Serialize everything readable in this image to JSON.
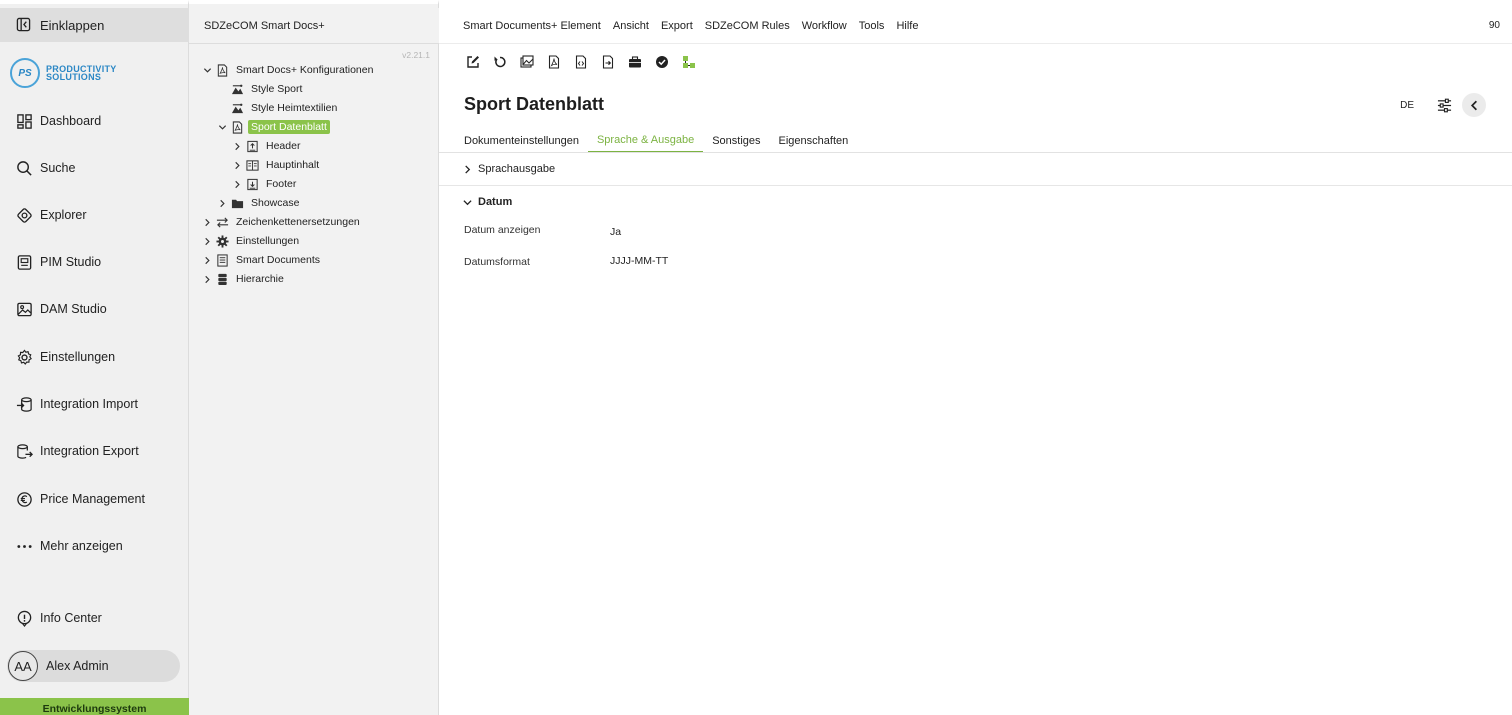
{
  "nav": {
    "collapse_label": "Einklappen",
    "logo_initials": "PS",
    "logo_line1": "PRODUCTIVITY",
    "logo_line2": "SOLUTIONS",
    "items": [
      {
        "label": "Dashboard",
        "icon": "dashboard-icon"
      },
      {
        "label": "Suche",
        "icon": "search-icon"
      },
      {
        "label": "Explorer",
        "icon": "explorer-icon"
      },
      {
        "label": "PIM Studio",
        "icon": "pim-studio-icon"
      },
      {
        "label": "DAM Studio",
        "icon": "image-icon"
      },
      {
        "label": "Einstellungen",
        "icon": "gear-icon"
      },
      {
        "label": "Integration Import",
        "icon": "import-icon"
      },
      {
        "label": "Integration Export",
        "icon": "export-icon"
      },
      {
        "label": "Price Management",
        "icon": "euro-icon"
      },
      {
        "label": "Mehr anzeigen",
        "icon": "more-icon"
      }
    ],
    "info_center": "Info Center",
    "user_initials": "AA",
    "user_name": "Alex Admin",
    "environment": "Entwicklungssystem"
  },
  "tree": {
    "header": "SDZeCOM Smart Docs+",
    "version": "v2.21.1",
    "nodes": [
      {
        "label": "Smart Docs+ Konfigurationen",
        "icon": "pdf-icon"
      },
      {
        "label": "Style Sport",
        "icon": "style-icon"
      },
      {
        "label": "Style Heimtextilien",
        "icon": "style-icon"
      },
      {
        "label": "Sport Datenblatt",
        "icon": "pdf-icon"
      },
      {
        "label": "Header",
        "icon": "header-icon"
      },
      {
        "label": "Hauptinhalt",
        "icon": "content-icon"
      },
      {
        "label": "Footer",
        "icon": "footer-icon"
      },
      {
        "label": "Showcase",
        "icon": "folder-icon"
      },
      {
        "label": "Zeichenkettenersetzungen",
        "icon": "swap-icon"
      },
      {
        "label": "Einstellungen",
        "icon": "gear-icon"
      },
      {
        "label": "Smart Documents",
        "icon": "document-icon"
      },
      {
        "label": "Hierarchie",
        "icon": "database-icon"
      }
    ]
  },
  "menu": {
    "items": [
      "Smart Documents+ Element",
      "Ansicht",
      "Export",
      "SDZeCOM Rules",
      "Workflow",
      "Tools",
      "Hilfe"
    ],
    "right_number": "90"
  },
  "toolbar_icons": [
    "edit-icon",
    "refresh-icon",
    "image-gallery-icon",
    "pdf-icon",
    "file-code-icon",
    "file-export-icon",
    "briefcase-icon",
    "check-circle-icon",
    "workflow-icon"
  ],
  "page": {
    "title": "Sport Datenblatt",
    "language": "DE",
    "tabs": [
      "Dokumenteinstellungen",
      "Sprache & Ausgabe",
      "Sonstiges",
      "Eigenschaften"
    ],
    "active_tab": 1,
    "section_collapsed": "Sprachausgabe",
    "section_expanded": "Datum",
    "fields": [
      {
        "label": "Datum anzeigen",
        "value": "Ja"
      },
      {
        "label": "Datumsformat",
        "value": "JJJJ-MM-TT"
      }
    ]
  },
  "colors": {
    "accent": "#8bc34a",
    "tab_active": "#7cb342",
    "logo_blue": "#2b87c5"
  }
}
